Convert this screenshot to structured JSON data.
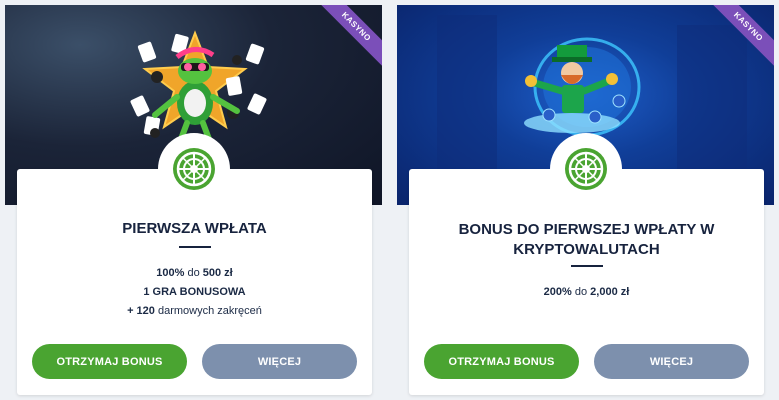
{
  "cards": [
    {
      "badge": "KASYNO",
      "title": "PIERWSZA WPŁATA",
      "lines": [
        {
          "bold": "100%",
          "mid": " do ",
          "bold2": "500 zł",
          "tail": ""
        },
        {
          "bold": "1 GRA BONUSOWA",
          "mid": "",
          "bold2": "",
          "tail": ""
        },
        {
          "bold": "+ 120",
          "mid": " darmowych zakręceń",
          "bold2": "",
          "tail": ""
        }
      ],
      "primary_button": "OTRZYMAJ BONUS",
      "secondary_button": "WIĘCEJ"
    },
    {
      "badge": "KASYNO",
      "title": "BONUS DO PIERWSZEJ WPŁATY W KRYPTOWALUTACH",
      "lines": [
        {
          "bold": "200%",
          "mid": " do ",
          "bold2": "2,000 zł",
          "tail": ""
        }
      ],
      "primary_button": "OTRZYMAJ BONUS",
      "secondary_button": "WIĘCEJ"
    }
  ],
  "colors": {
    "primary_button": "#4aa431",
    "secondary_button": "#7d90ad",
    "ribbon": "#7b4fb9",
    "title": "#17233e"
  },
  "icons": [
    "roulette-icon",
    "frog-casino-illustration",
    "leprechaun-crypto-illustration"
  ]
}
